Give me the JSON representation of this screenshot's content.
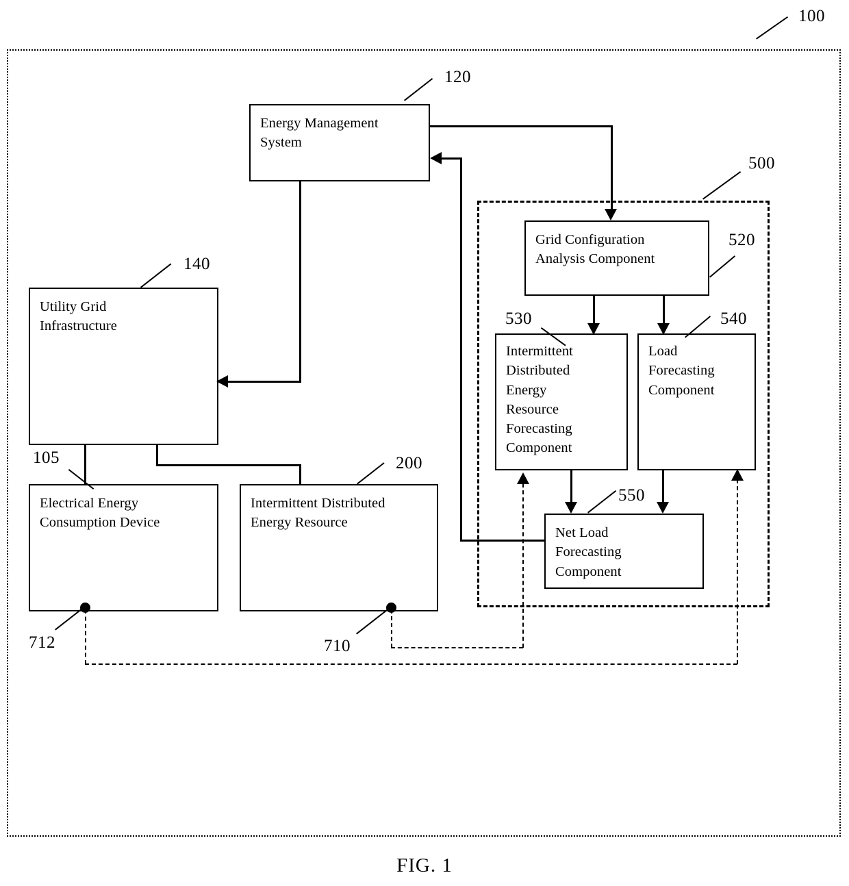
{
  "figure": {
    "caption": "FIG. 1",
    "system_ref": "100"
  },
  "boundaries": {
    "system": {
      "ref": "100",
      "style": "dotted"
    },
    "forecasting_subsystem": {
      "ref": "500",
      "style": "dashed"
    }
  },
  "blocks": [
    {
      "id": "energy-management-system",
      "ref": "120",
      "label": "Energy Management\nSystem"
    },
    {
      "id": "utility-grid-infrastructure",
      "ref": "140",
      "label": "Utility Grid\nInfrastructure"
    },
    {
      "id": "electrical-energy-consumption-device",
      "ref": "105",
      "label": "Electrical Energy\nConsumption Device"
    },
    {
      "id": "intermittent-distributed-energy-resource",
      "ref": "200",
      "label": "Intermittent Distributed\nEnergy Resource"
    },
    {
      "id": "grid-configuration-analysis-component",
      "ref": "520",
      "label": "Grid Configuration\nAnalysis Component"
    },
    {
      "id": "ider-forecasting-component",
      "ref": "530",
      "label": "Intermittent\nDistributed\nEnergy\nResource\nForecasting\nComponent"
    },
    {
      "id": "load-forecasting-component",
      "ref": "540",
      "label": "Load\nForecasting\nComponent"
    },
    {
      "id": "net-load-forecasting-component",
      "ref": "550",
      "label": "Net Load\nForecasting\nComponent"
    }
  ],
  "sensors": [
    {
      "id": "consumption-device-sensor",
      "ref": "712"
    },
    {
      "id": "ider-sensor",
      "ref": "710"
    }
  ],
  "colors": {
    "line": "#000000",
    "background": "#ffffff"
  }
}
